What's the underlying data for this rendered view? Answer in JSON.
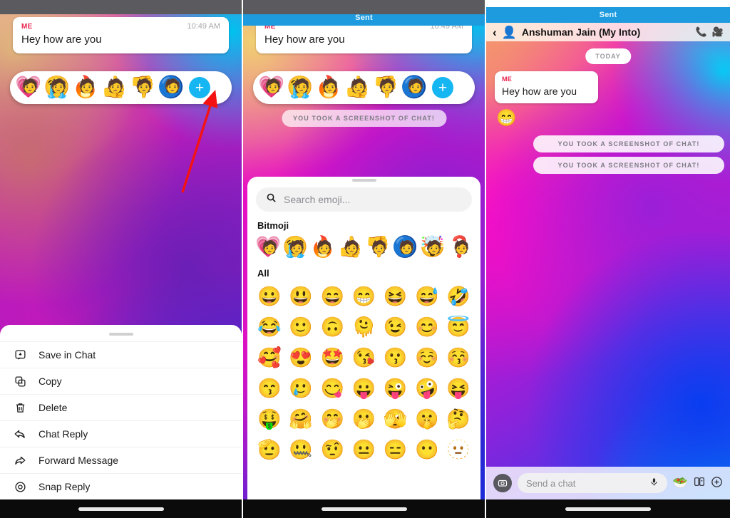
{
  "message": {
    "sender_label": "ME",
    "time": "10:49 AM",
    "text": "Hey how are you"
  },
  "status_banner": {
    "label": "Sent"
  },
  "reaction_tray": {
    "items": [
      {
        "name": "heart-bitmoji",
        "bg": "💗",
        "face": "🧑"
      },
      {
        "name": "crying-bitmoji",
        "bg": "😭",
        "face": "🧑"
      },
      {
        "name": "fire-bitmoji",
        "bg": "🔥",
        "face": "🧑"
      },
      {
        "name": "thumbs-up-bitmoji",
        "bg": "👍",
        "face": "🧑"
      },
      {
        "name": "thumbs-down-bitmoji",
        "bg": "👎",
        "face": "🧑"
      },
      {
        "name": "neutral-bitmoji",
        "bg": "🔵",
        "face": "🧑"
      }
    ],
    "add_label": "+"
  },
  "context_menu": {
    "items": [
      {
        "label": "Save in Chat",
        "icon": "save-in-chat-icon"
      },
      {
        "label": "Copy",
        "icon": "copy-icon"
      },
      {
        "label": "Delete",
        "icon": "trash-icon"
      },
      {
        "label": "Chat Reply",
        "icon": "chat-reply-icon"
      },
      {
        "label": "Forward Message",
        "icon": "forward-message-icon"
      },
      {
        "label": "Snap Reply",
        "icon": "snap-reply-icon"
      }
    ]
  },
  "toast": {
    "text": "YOU TOOK A SCREENSHOT OF CHAT!"
  },
  "picker": {
    "search_placeholder": "Search emoji...",
    "search_icon": "search-icon",
    "bitmoji_title": "Bitmoji",
    "bitmoji": [
      {
        "name": "heart-bitmoji",
        "bg": "💗",
        "face": "🧑"
      },
      {
        "name": "crying-bitmoji",
        "bg": "😭",
        "face": "🧑"
      },
      {
        "name": "fire-bitmoji",
        "bg": "🔥",
        "face": "🧑"
      },
      {
        "name": "thumbs-up-bitmoji",
        "bg": "👍",
        "face": "🧑"
      },
      {
        "name": "thumbs-down-bitmoji",
        "bg": "👎",
        "face": "🧑"
      },
      {
        "name": "neutral-bitmoji",
        "bg": "🔵",
        "face": "🧑"
      },
      {
        "name": "mind-blown-bitmoji",
        "bg": "🤯",
        "face": "🧑"
      },
      {
        "name": "question-bitmoji",
        "bg": "❓",
        "face": "🧑"
      }
    ],
    "all_title": "All",
    "all_rows": [
      [
        "😀",
        "😃",
        "😄",
        "😁",
        "😆",
        "😅",
        "🤣"
      ],
      [
        "😂",
        "🙂",
        "🙃",
        "🫠",
        "😉",
        "😊",
        "😇"
      ],
      [
        "🥰",
        "😍",
        "🤩",
        "😘",
        "😗",
        "☺️",
        "😚"
      ],
      [
        "😙",
        "🥲",
        "😋",
        "😛",
        "😜",
        "🤪",
        "😝"
      ],
      [
        "🤑",
        "🤗",
        "🤭",
        "🫢",
        "🫣",
        "🤫",
        "🤔"
      ],
      [
        "🫡",
        "🤐",
        "🤨",
        "😐",
        "😑",
        "😶",
        "🫥"
      ]
    ]
  },
  "conversation": {
    "back_icon": "back-chevron-icon",
    "avatar_icon": "avatar-bitmoji",
    "title": "Anshuman Jain (My Into)",
    "call_icon": "phone-icon",
    "video_icon": "video-camera-icon",
    "day_divider": "TODAY",
    "reaction": "😁",
    "toasts": [
      "YOU TOOK A SCREENSHOT OF CHAT!",
      "YOU TOOK A SCREENSHOT OF CHAT!"
    ]
  },
  "chatbar": {
    "camera_icon": "camera-icon",
    "placeholder": "Send a chat",
    "mic_icon": "microphone-icon",
    "bitmoji_icon": "🥗",
    "stickers_icon": "stickers-icon",
    "plus_icon": "plus-icon"
  },
  "annotation": {
    "arrow_color": "#f41212"
  }
}
